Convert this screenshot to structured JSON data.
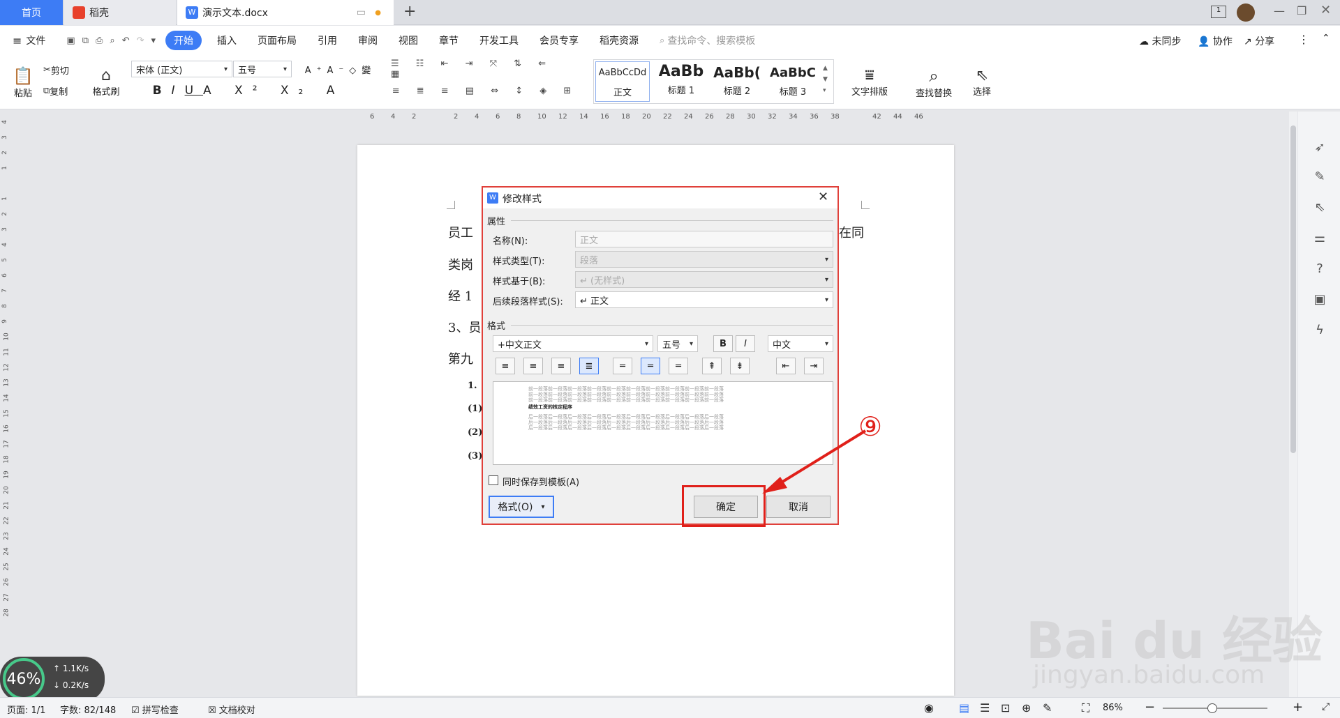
{
  "tabs": {
    "home": "首页",
    "daoke": "稻壳",
    "doc": "演示文本.docx",
    "new_tab": "+"
  },
  "menu": {
    "file": "文件",
    "items": [
      "开始",
      "插入",
      "页面布局",
      "引用",
      "审阅",
      "视图",
      "章节",
      "开发工具",
      "会员专享",
      "稻壳资源"
    ],
    "search": "查找命令、搜索模板",
    "sync": "未同步",
    "collab": "协作",
    "share": "分享"
  },
  "ribbon": {
    "paste": "粘贴",
    "cut": "剪切",
    "copy": "复制",
    "format_painter": "格式刷",
    "font": "宋体 (正文)",
    "size": "五号",
    "styles": [
      {
        "preview": "AaBbCcDd",
        "name": "正文"
      },
      {
        "preview": "AaBb",
        "name": "标题 1"
      },
      {
        "preview": "AaBb(",
        "name": "标题 2"
      },
      {
        "preview": "AaBbC",
        "name": "标题 3"
      }
    ],
    "text_layout": "文字排版",
    "find_replace": "查找替换",
    "select": "选择"
  },
  "ruler": [
    "6",
    "4",
    "2",
    "",
    "2",
    "4",
    "6",
    "8",
    "10",
    "12",
    "14",
    "16",
    "18",
    "20",
    "22",
    "24",
    "26",
    "28",
    "30",
    "32",
    "34",
    "36",
    "38",
    "",
    "42",
    "44",
    "46"
  ],
  "vruler": [
    "4",
    "3",
    "2",
    "1",
    "",
    "1",
    "2",
    "3",
    "4",
    "5",
    "6",
    "7",
    "8",
    "9",
    "10",
    "11",
    "12",
    "13",
    "14",
    "15",
    "16",
    "17",
    "18",
    "19",
    "20",
    "21",
    "22",
    "23",
    "24",
    "25",
    "26",
    "27",
    "28"
  ],
  "doc_lines": [
    "员工",
    "在同",
    "类岗",
    "经 1",
    "3、员",
    "第九",
    "1.",
    "(1)",
    "(2)",
    "(3)"
  ],
  "dialog": {
    "title": "修改样式",
    "section_props": "属性",
    "name_label": "名称(N):",
    "name_value": "正文",
    "type_label": "样式类型(T):",
    "type_value": "段落",
    "based_label": "样式基于(B):",
    "based_value": "↵ (无样式)",
    "next_label": "后续段落样式(S):",
    "next_value": "↵ 正文",
    "section_format": "格式",
    "font": "+中文正文",
    "size": "五号",
    "bold": "B",
    "italic": "I",
    "lang": "中文",
    "preview_prev": "前一段落前一段落前一段落前一段落前一段落前一段落前一段落前一段落前一段落前一段落",
    "preview_sample": "绩效工资的核定程序",
    "preview_next": "后一段落后一段落后一段落后一段落后一段落后一段落后一段落后一段落后一段落后一段落",
    "save_template": "同时保存到模板(A)",
    "format_btn": "格式(O)",
    "ok": "确定",
    "cancel": "取消"
  },
  "annotation": "⑨",
  "status": {
    "page": "页面: 1/1",
    "words": "字数: 82/148",
    "spell": "拼写检查",
    "proof": "文档校对",
    "zoom": "86%",
    "net_percent": "46%",
    "up": "1.1K/s",
    "down": "0.2K/s"
  },
  "watermark": {
    "brand": "Bai du 经验",
    "url": "jingyan.baidu.com"
  },
  "colors": {
    "accent": "#3d7cf5",
    "annotation": "#e0201a"
  }
}
